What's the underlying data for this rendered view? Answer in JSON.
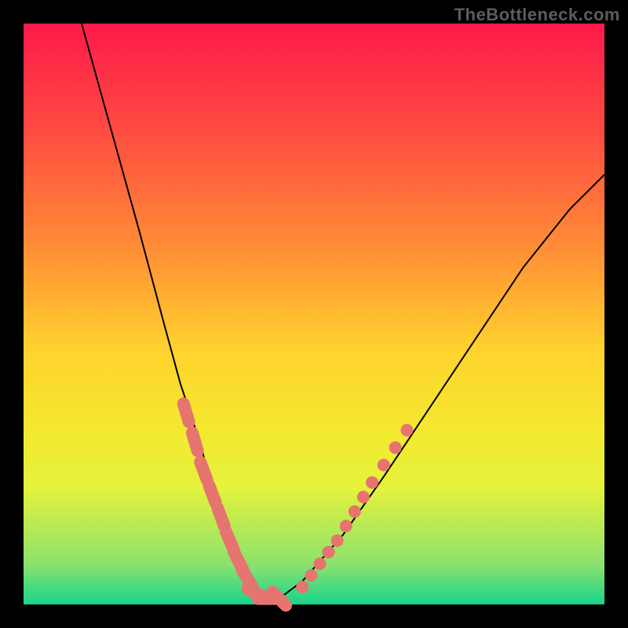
{
  "watermark": "TheBottleneck.com",
  "chart_data": {
    "type": "line",
    "title": "",
    "xlabel": "",
    "ylabel": "",
    "xlim": [
      0,
      100
    ],
    "ylim": [
      0,
      100
    ],
    "grid": false,
    "legend": false,
    "series": [
      {
        "name": "curve",
        "color": "#000000",
        "x": [
          10,
          15,
          20,
          24,
          27,
          30,
          32,
          34,
          36,
          38,
          40,
          44,
          48,
          55,
          62,
          70,
          78,
          86,
          94,
          100
        ],
        "y": [
          100,
          82,
          64,
          49,
          38,
          29,
          22,
          15,
          9,
          4,
          1,
          1,
          4,
          12,
          22,
          34,
          46,
          58,
          68,
          74
        ]
      }
    ],
    "markers": [
      {
        "name": "left-cluster",
        "color": "#e6746f",
        "style": "rounded-dash",
        "x": [
          28,
          29.5,
          31,
          32.5,
          34,
          35.5,
          37,
          38.5,
          40,
          42,
          44
        ],
        "y": [
          33,
          28,
          23,
          19,
          15,
          11,
          7.5,
          4.5,
          2,
          1,
          1
        ]
      },
      {
        "name": "right-cluster",
        "color": "#e6746f",
        "style": "dot",
        "x": [
          48,
          49.5,
          51,
          52.5,
          54,
          55.5,
          57,
          58.5,
          60,
          62,
          64,
          66
        ],
        "y": [
          3,
          5,
          7,
          9,
          11,
          13.5,
          16,
          18.5,
          21,
          24,
          27,
          30
        ]
      }
    ],
    "background_gradient": [
      "#fe1a4a",
      "#ff8b36",
      "#ffd22e",
      "#e4f23c",
      "#18d48c"
    ]
  }
}
